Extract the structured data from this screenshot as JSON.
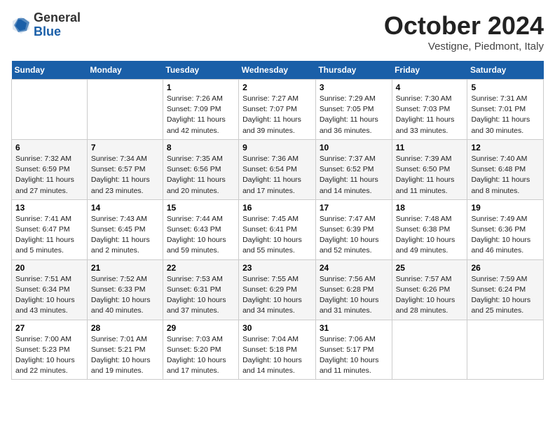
{
  "header": {
    "logo_general": "General",
    "logo_blue": "Blue",
    "month_title": "October 2024",
    "subtitle": "Vestigne, Piedmont, Italy"
  },
  "days_of_week": [
    "Sunday",
    "Monday",
    "Tuesday",
    "Wednesday",
    "Thursday",
    "Friday",
    "Saturday"
  ],
  "weeks": [
    [
      {
        "num": "",
        "info": ""
      },
      {
        "num": "",
        "info": ""
      },
      {
        "num": "1",
        "info": "Sunrise: 7:26 AM\nSunset: 7:09 PM\nDaylight: 11 hours and 42 minutes."
      },
      {
        "num": "2",
        "info": "Sunrise: 7:27 AM\nSunset: 7:07 PM\nDaylight: 11 hours and 39 minutes."
      },
      {
        "num": "3",
        "info": "Sunrise: 7:29 AM\nSunset: 7:05 PM\nDaylight: 11 hours and 36 minutes."
      },
      {
        "num": "4",
        "info": "Sunrise: 7:30 AM\nSunset: 7:03 PM\nDaylight: 11 hours and 33 minutes."
      },
      {
        "num": "5",
        "info": "Sunrise: 7:31 AM\nSunset: 7:01 PM\nDaylight: 11 hours and 30 minutes."
      }
    ],
    [
      {
        "num": "6",
        "info": "Sunrise: 7:32 AM\nSunset: 6:59 PM\nDaylight: 11 hours and 27 minutes."
      },
      {
        "num": "7",
        "info": "Sunrise: 7:34 AM\nSunset: 6:57 PM\nDaylight: 11 hours and 23 minutes."
      },
      {
        "num": "8",
        "info": "Sunrise: 7:35 AM\nSunset: 6:56 PM\nDaylight: 11 hours and 20 minutes."
      },
      {
        "num": "9",
        "info": "Sunrise: 7:36 AM\nSunset: 6:54 PM\nDaylight: 11 hours and 17 minutes."
      },
      {
        "num": "10",
        "info": "Sunrise: 7:37 AM\nSunset: 6:52 PM\nDaylight: 11 hours and 14 minutes."
      },
      {
        "num": "11",
        "info": "Sunrise: 7:39 AM\nSunset: 6:50 PM\nDaylight: 11 hours and 11 minutes."
      },
      {
        "num": "12",
        "info": "Sunrise: 7:40 AM\nSunset: 6:48 PM\nDaylight: 11 hours and 8 minutes."
      }
    ],
    [
      {
        "num": "13",
        "info": "Sunrise: 7:41 AM\nSunset: 6:47 PM\nDaylight: 11 hours and 5 minutes."
      },
      {
        "num": "14",
        "info": "Sunrise: 7:43 AM\nSunset: 6:45 PM\nDaylight: 11 hours and 2 minutes."
      },
      {
        "num": "15",
        "info": "Sunrise: 7:44 AM\nSunset: 6:43 PM\nDaylight: 10 hours and 59 minutes."
      },
      {
        "num": "16",
        "info": "Sunrise: 7:45 AM\nSunset: 6:41 PM\nDaylight: 10 hours and 55 minutes."
      },
      {
        "num": "17",
        "info": "Sunrise: 7:47 AM\nSunset: 6:39 PM\nDaylight: 10 hours and 52 minutes."
      },
      {
        "num": "18",
        "info": "Sunrise: 7:48 AM\nSunset: 6:38 PM\nDaylight: 10 hours and 49 minutes."
      },
      {
        "num": "19",
        "info": "Sunrise: 7:49 AM\nSunset: 6:36 PM\nDaylight: 10 hours and 46 minutes."
      }
    ],
    [
      {
        "num": "20",
        "info": "Sunrise: 7:51 AM\nSunset: 6:34 PM\nDaylight: 10 hours and 43 minutes."
      },
      {
        "num": "21",
        "info": "Sunrise: 7:52 AM\nSunset: 6:33 PM\nDaylight: 10 hours and 40 minutes."
      },
      {
        "num": "22",
        "info": "Sunrise: 7:53 AM\nSunset: 6:31 PM\nDaylight: 10 hours and 37 minutes."
      },
      {
        "num": "23",
        "info": "Sunrise: 7:55 AM\nSunset: 6:29 PM\nDaylight: 10 hours and 34 minutes."
      },
      {
        "num": "24",
        "info": "Sunrise: 7:56 AM\nSunset: 6:28 PM\nDaylight: 10 hours and 31 minutes."
      },
      {
        "num": "25",
        "info": "Sunrise: 7:57 AM\nSunset: 6:26 PM\nDaylight: 10 hours and 28 minutes."
      },
      {
        "num": "26",
        "info": "Sunrise: 7:59 AM\nSunset: 6:24 PM\nDaylight: 10 hours and 25 minutes."
      }
    ],
    [
      {
        "num": "27",
        "info": "Sunrise: 7:00 AM\nSunset: 5:23 PM\nDaylight: 10 hours and 22 minutes."
      },
      {
        "num": "28",
        "info": "Sunrise: 7:01 AM\nSunset: 5:21 PM\nDaylight: 10 hours and 19 minutes."
      },
      {
        "num": "29",
        "info": "Sunrise: 7:03 AM\nSunset: 5:20 PM\nDaylight: 10 hours and 17 minutes."
      },
      {
        "num": "30",
        "info": "Sunrise: 7:04 AM\nSunset: 5:18 PM\nDaylight: 10 hours and 14 minutes."
      },
      {
        "num": "31",
        "info": "Sunrise: 7:06 AM\nSunset: 5:17 PM\nDaylight: 10 hours and 11 minutes."
      },
      {
        "num": "",
        "info": ""
      },
      {
        "num": "",
        "info": ""
      }
    ]
  ]
}
